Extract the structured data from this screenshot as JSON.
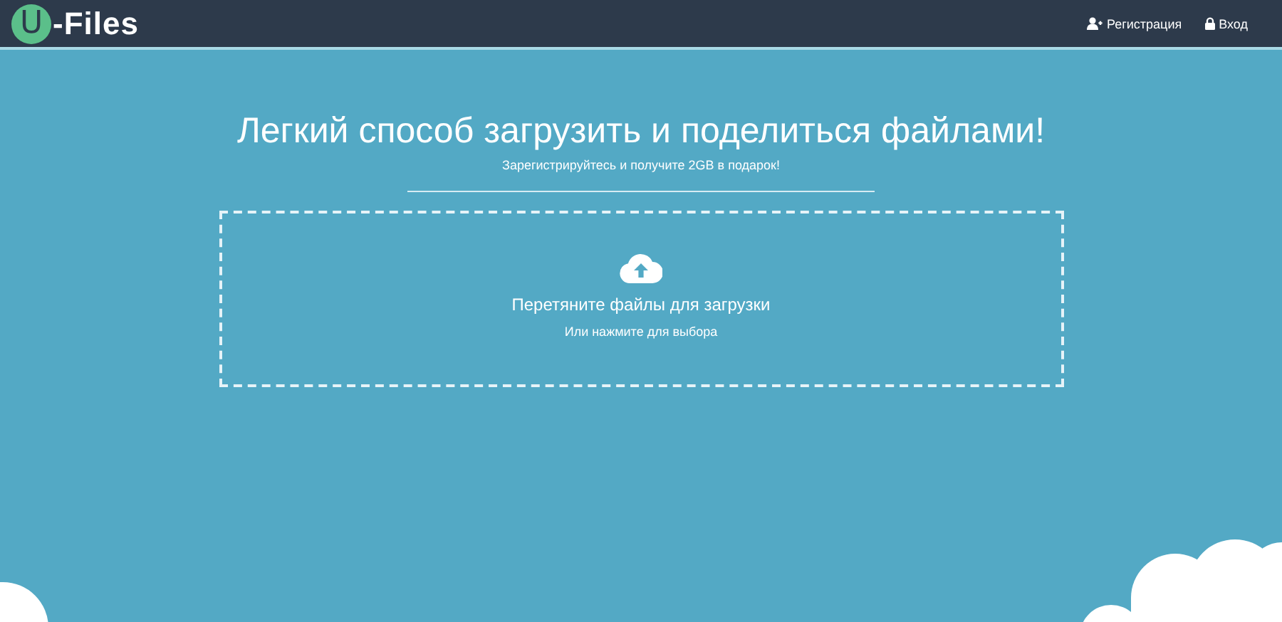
{
  "header": {
    "logo": {
      "letter": "U",
      "text": "-Files"
    },
    "nav": [
      {
        "kind": "register",
        "label": "Регистрация"
      },
      {
        "kind": "login",
        "label": "Вход"
      }
    ]
  },
  "hero": {
    "title": "Легкий способ загрузить и поделиться файлами!",
    "subtitle": "Зарегистрируйтесь и получите 2GB в подарок!"
  },
  "dropzone": {
    "title": "Перетяните файлы для загрузки",
    "hint": "Или нажмите для выбора"
  }
}
